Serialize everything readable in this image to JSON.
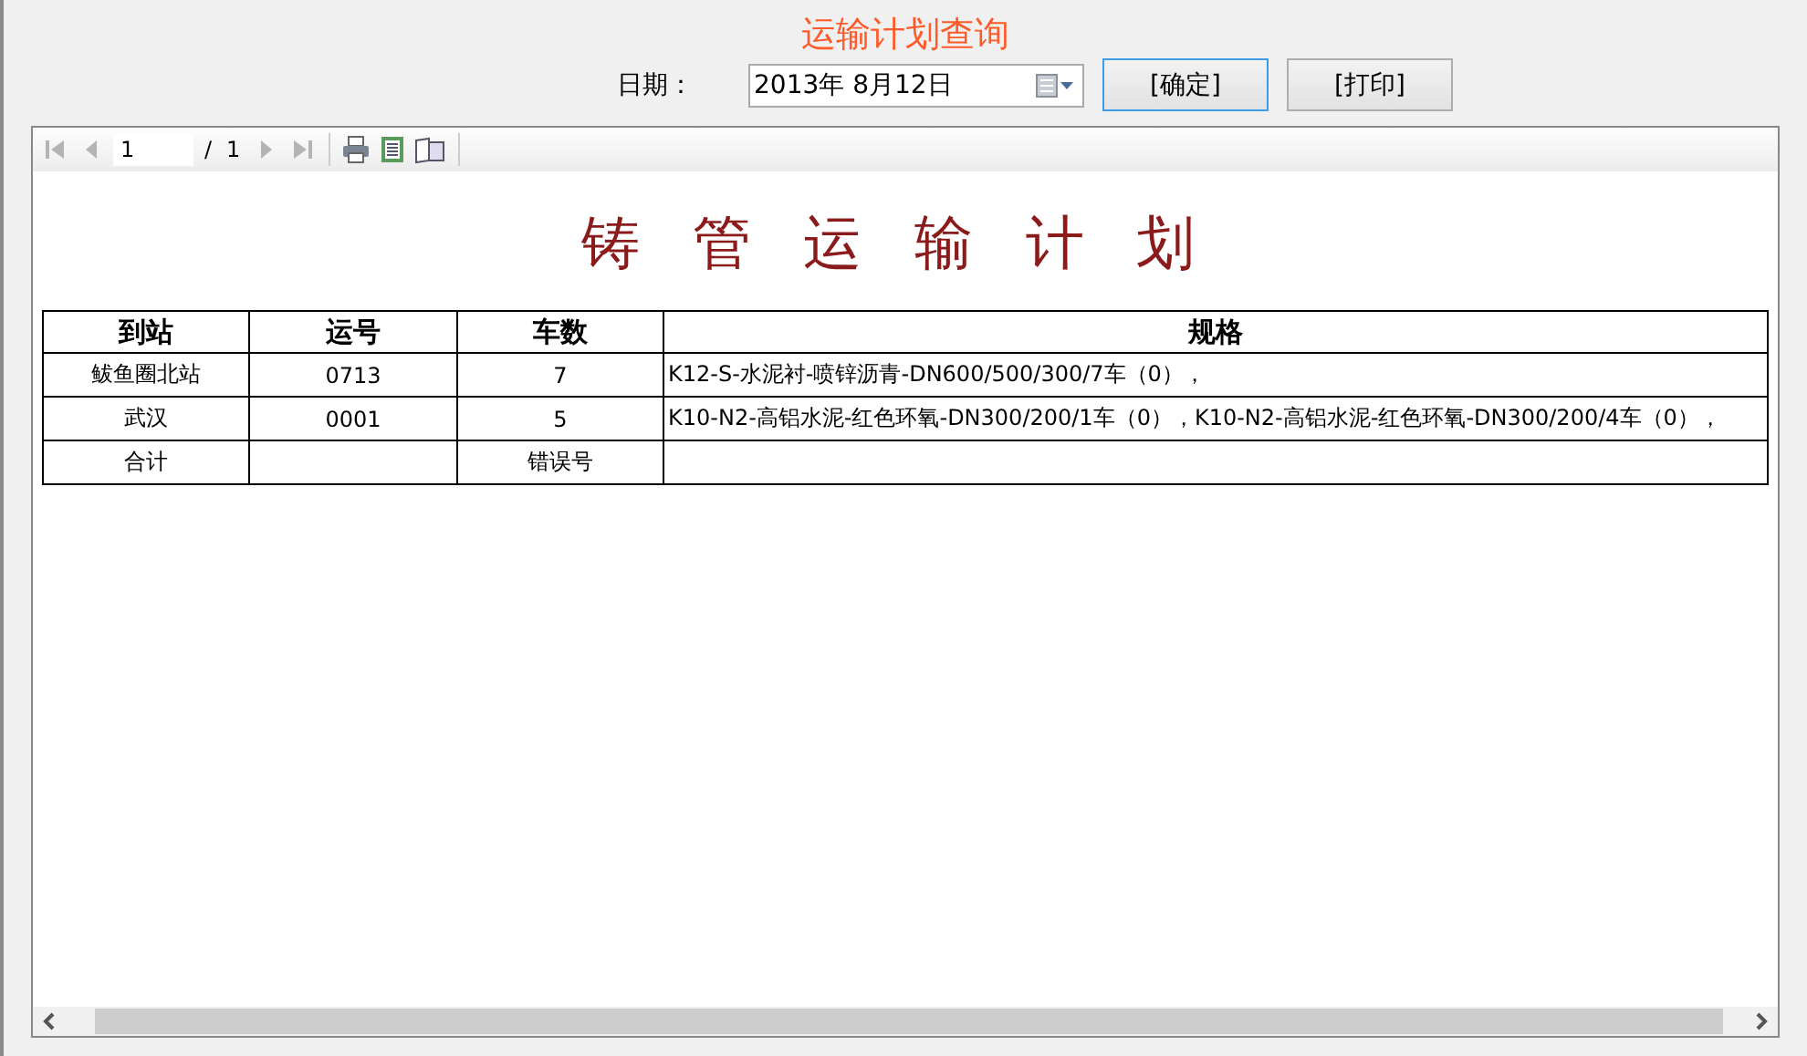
{
  "page_title": "运输计划查询",
  "date_filter": {
    "label": "日期：",
    "value": "2013年  8月12日"
  },
  "buttons": [
    {
      "label": "[确定]",
      "focused": true
    },
    {
      "label": "[打印]",
      "focused": false
    }
  ],
  "viewer_toolbar": {
    "nav": [
      {
        "kind": "first",
        "disabled": true
      },
      {
        "kind": "prev",
        "disabled": true
      }
    ],
    "page": "1",
    "separator": "/",
    "total_pages": "1",
    "nav_after": [
      {
        "kind": "next",
        "disabled": true
      },
      {
        "kind": "last",
        "disabled": true
      }
    ]
  },
  "report": {
    "title": "铸管运输计划",
    "table": {
      "columns": [
        "到站",
        "运号",
        "车数",
        "规格"
      ],
      "rows": [
        [
          "鲅鱼圈北站",
          "0713",
          "7",
          "K12-S-水泥衬-喷锌沥青-DN600/500/300/7车（0），"
        ],
        [
          "武汉",
          "0001",
          "5",
          "K10-N2-高铝水泥-红色环氧-DN300/200/1车（0），K10-N2-高铝水泥-红色环氧-DN300/200/4车（0），"
        ],
        [
          "合计",
          "",
          "错误号",
          ""
        ]
      ]
    }
  }
}
